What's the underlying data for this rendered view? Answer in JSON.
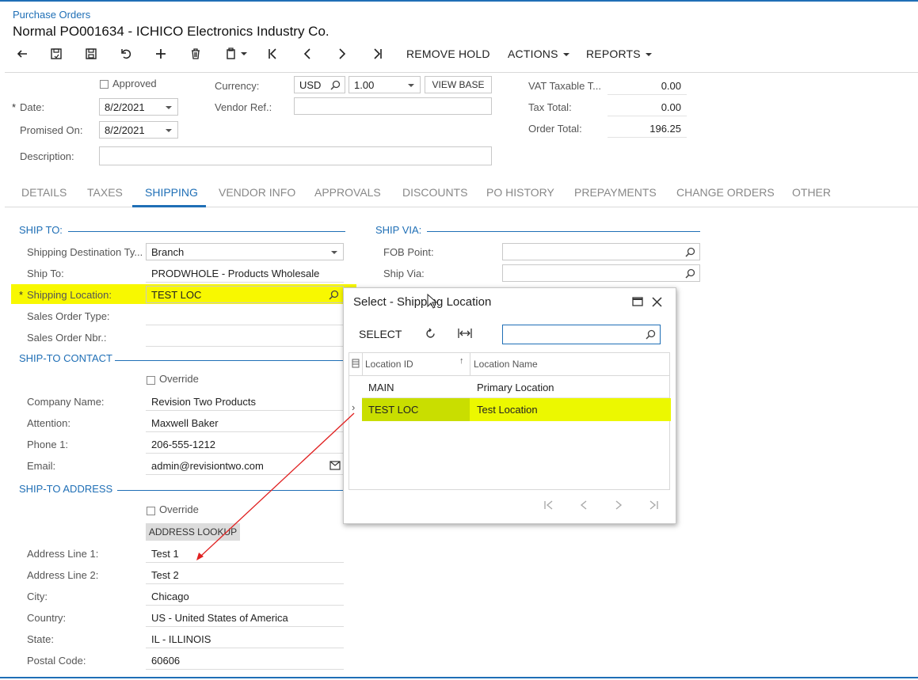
{
  "breadcrumb": "Purchase Orders",
  "title": "Normal PO001634 - ICHICO Electronics Industry Co.",
  "toolbar": {
    "remove_hold": "REMOVE HOLD",
    "actions": "ACTIONS",
    "reports": "REPORTS"
  },
  "header": {
    "approved_label": "Approved",
    "date_label": "Date:",
    "date_value": "8/2/2021",
    "promised_label": "Promised On:",
    "promised_value": "8/2/2021",
    "description_label": "Description:",
    "description_value": "",
    "currency_label": "Currency:",
    "currency_value": "USD",
    "rate_value": "1.00",
    "view_base": "VIEW BASE",
    "vendor_ref_label": "Vendor Ref.:",
    "vendor_ref_value": "",
    "vat_label": "VAT Taxable T...",
    "vat_value": "0.00",
    "tax_total_label": "Tax Total:",
    "tax_total_value": "0.00",
    "order_total_label": "Order Total:",
    "order_total_value": "196.25"
  },
  "tabs": [
    "DETAILS",
    "TAXES",
    "SHIPPING",
    "VENDOR INFO",
    "APPROVALS",
    "DISCOUNTS",
    "PO HISTORY",
    "PREPAYMENTS",
    "CHANGE ORDERS",
    "OTHER"
  ],
  "ship_to": {
    "section": "SHIP TO:",
    "dest_type_label": "Shipping Destination Ty...",
    "dest_type_value": "Branch",
    "ship_to_label": "Ship To:",
    "ship_to_value": "PRODWHOLE - Products Wholesale",
    "location_label": "Shipping Location:",
    "location_value": "TEST LOC",
    "so_type_label": "Sales Order Type:",
    "so_nbr_label": "Sales Order Nbr.:"
  },
  "ship_via": {
    "section": "SHIP VIA:",
    "fob_label": "FOB Point:",
    "ship_via_label": "Ship Via:"
  },
  "contact": {
    "section": "SHIP-TO CONTACT",
    "override": "Override",
    "company_label": "Company Name:",
    "company_value": "Revision Two Products",
    "attention_label": "Attention:",
    "attention_value": "Maxwell Baker",
    "phone_label": "Phone 1:",
    "phone_value": "206-555-1212",
    "email_label": "Email:",
    "email_value": "admin@revisiontwo.com"
  },
  "address": {
    "section": "SHIP-TO ADDRESS",
    "override": "Override",
    "lookup": "ADDRESS LOOKUP",
    "line1_label": "Address Line 1:",
    "line1_value": "Test 1",
    "line2_label": "Address Line 2:",
    "line2_value": "Test 2",
    "city_label": "City:",
    "city_value": "Chicago",
    "country_label": "Country:",
    "country_value": "US - United States of America",
    "state_label": "State:",
    "state_value": "IL - ILLINOIS",
    "postal_label": "Postal Code:",
    "postal_value": "60606"
  },
  "dialog": {
    "title": "Select - Shipping Location",
    "select": "SELECT",
    "search_value": "",
    "col_id": "Location ID",
    "col_name": "Location Name",
    "rows": [
      {
        "id": "MAIN",
        "name": "Primary Location"
      },
      {
        "id": "TEST LOC",
        "name": "Test Location"
      }
    ]
  },
  "colors": {
    "accent": "#1f6fb6",
    "highlight": "#f8f800",
    "arrow": "#e02020"
  }
}
